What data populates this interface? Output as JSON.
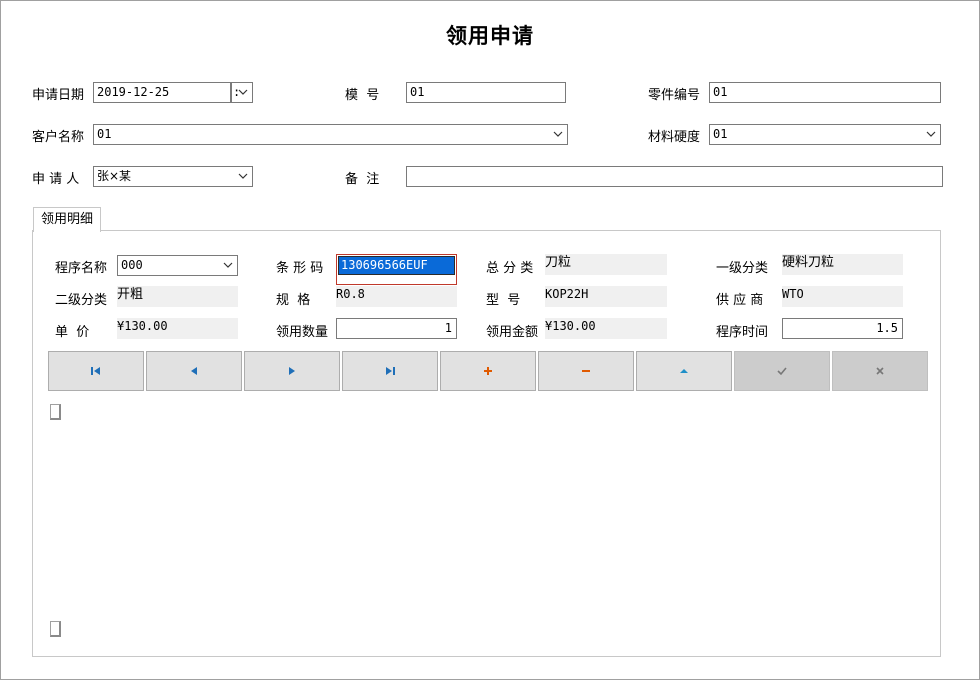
{
  "title": "领用申请",
  "header": {
    "apply_date_label": "申请日期",
    "apply_date_value": "2019-12-25",
    "date_extra": ":",
    "model_label": "模  号",
    "model_value": "01",
    "part_no_label": "零件编号",
    "part_no_value": "01",
    "customer_label": "客户名称",
    "customer_value": "01",
    "hardness_label": "材料硬度",
    "hardness_value": "01",
    "applicant_label": "申 请 人",
    "applicant_value": "张×某",
    "remark_label": "备  注",
    "remark_value": ""
  },
  "tab": {
    "label": "领用明细"
  },
  "detail": {
    "program_name_label": "程序名称",
    "program_name_value": "000",
    "barcode_label": "条 形 码",
    "barcode_value": "130696566EUF",
    "total_cat_label": "总 分 类",
    "total_cat_value": "刀粒",
    "level1_label": "一级分类",
    "level1_value": "硬料刀粒",
    "level2_label": "二级分类",
    "level2_value": "开粗",
    "spec_label": "规  格",
    "spec_value": "R0.8",
    "type_label": "型  号",
    "type_value": "KOP22H",
    "supplier_label": "供 应 商",
    "supplier_value": "WTO",
    "price_label": "单  价",
    "price_value": "¥130.00",
    "qty_label": "领用数量",
    "qty_value": "1",
    "amount_label": "领用金额",
    "amount_value": "¥130.00",
    "prog_time_label": "程序时间",
    "prog_time_value": "1.5"
  },
  "navigator": [
    "first-record-icon",
    "prior-record-icon",
    "next-record-icon",
    "last-record-icon",
    "insert-icon",
    "delete-icon",
    "edit-icon",
    "post-icon",
    "cancel-icon"
  ]
}
